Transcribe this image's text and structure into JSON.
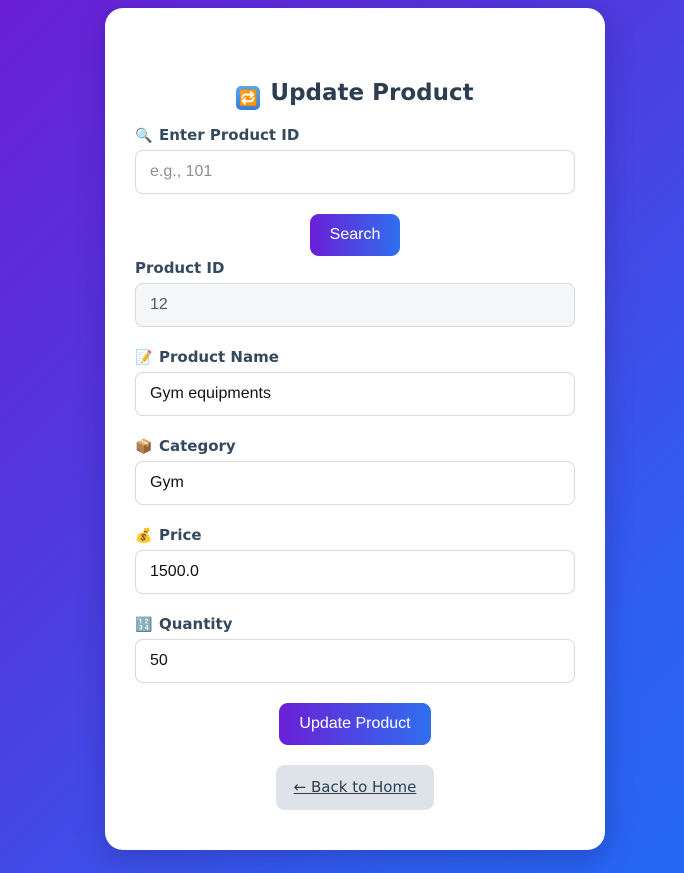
{
  "page": {
    "title": "Update Product",
    "title_icon": "🔁"
  },
  "search": {
    "label": "Enter Product ID",
    "label_icon": "🔍",
    "placeholder": "e.g., 101",
    "value": "",
    "button_label": "Search"
  },
  "form": {
    "product_id": {
      "label": "Product ID",
      "value": "12"
    },
    "product_name": {
      "label": "Product Name",
      "icon": "📝",
      "value": "Gym equipments"
    },
    "category": {
      "label": "Category",
      "icon": "📦",
      "value": "Gym"
    },
    "price": {
      "label": "Price",
      "icon": "💰",
      "value": "1500.0"
    },
    "quantity": {
      "label": "Quantity",
      "icon": "🔢",
      "value": "50"
    },
    "submit_label": "Update Product"
  },
  "nav": {
    "back_label": "← Back to Home"
  },
  "colors": {
    "gradient_start": "#6a1fd6",
    "gradient_end": "#2567f2",
    "card_bg": "#ffffff",
    "label_color": "#34495e"
  }
}
